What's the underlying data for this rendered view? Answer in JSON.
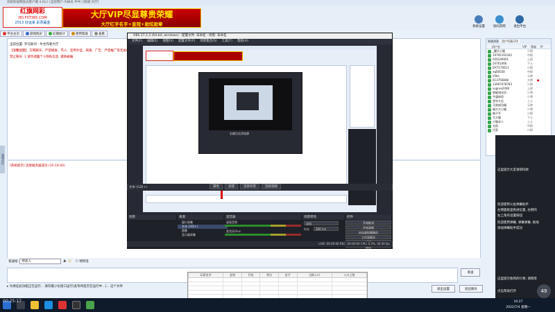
{
  "window_title": "云帆科技网会员客户端 4.0(c) (当前用户:大帐号 牛牛) [频道:大厅]",
  "logo": {
    "line1": "红旗网彩",
    "line2": "HD.FXT365.COM",
    "line3": "2013 好运来 彩票赢金"
  },
  "vip_banner": {
    "title": "大厅VIP尽显尊贵荣耀",
    "subtitle": "大厅红字名字+皇冠+勋炫勋章"
  },
  "window_buttons": [
    {
      "label": "系统设置"
    },
    {
      "label": "语问其网"
    },
    {
      "label": "退出平台"
    }
  ],
  "nav": [
    "平台主页",
    "游戏购买",
    "彩期统计",
    "使用帮助",
    "查看"
  ],
  "chat": {
    "lines": [
      {
        "text": "当前位置: 罗马斯对 - 牛合作者大厅",
        "color": "#222"
      },
      {
        "text": "【温馨提醒】 方网聊天、严禁刷屏、骂人、宣传外挂、病毒、广告、严禁推广等无关话题, 违者立即拉黑!",
        "color": "#c00"
      },
      {
        "text": "禁止聊天: 1 请勿透露个人隐私信息, 谨防被骗",
        "color": "#c00"
      },
      {
        "text": "[系统提示] 连接服务器成功 (10:19:40)",
        "color": "#c00"
      }
    ]
  },
  "left_strip": "游戏大厅",
  "user_panel": {
    "tabs": [
      "系统消息",
      "用户列表(20)"
    ],
    "headers": [
      "用户名",
      "VIP",
      "等级",
      "IP"
    ],
    "users": [
      {
        "name": "_醒天小猫",
        "rank": "少尉",
        "flag": ""
      },
      {
        "name": "19792192342",
        "rank": "中尉",
        "flag": ""
      },
      {
        "name": "A56249001",
        "rank": "上尉",
        "flag": ""
      },
      {
        "name": "54761066",
        "rank": "下士",
        "flag": ""
      },
      {
        "name": "DX7170011",
        "rank": "少尉",
        "flag": ""
      },
      {
        "name": "eq00030",
        "rank": "中尉",
        "flag": ""
      },
      {
        "name": "lrlike",
        "rank": "元帅",
        "flag": ""
      },
      {
        "name": "013756848",
        "rank": "大将",
        "flag": "●"
      },
      {
        "name": "13907078783",
        "rank": "少尉",
        "flag": ""
      },
      {
        "name": "sugrue2008",
        "rank": "上尉",
        "flag": ""
      },
      {
        "name": "智能测试员",
        "rank": "少将",
        "flag": ""
      },
      {
        "name": "牛逼体验",
        "rank": "少将",
        "flag": ""
      },
      {
        "name": "虎年大吉",
        "rank": "上士",
        "flag": ""
      },
      {
        "name": "马到成功福",
        "rank": "元帅",
        "flag": ""
      },
      {
        "name": "福大大小猫",
        "rank": "少将",
        "flag": ""
      },
      {
        "name": "做子手",
        "rank": "少尉",
        "flag": ""
      },
      {
        "name": "大大猫",
        "rank": "下士",
        "flag": ""
      },
      {
        "name": "小猫本人",
        "rank": "上士",
        "flag": ""
      },
      {
        "name": "太阳",
        "rank": "中尉",
        "flag": ""
      },
      {
        "name": "月亮",
        "rank": "少尉",
        "flag": ""
      }
    ]
  },
  "send_bar": {
    "label": "发送给:",
    "target": "所有人",
    "option": "悄悄话"
  },
  "send_button": "发送",
  "bottom_text": "为保证此功能正在运行... 请勿最小化窗口运行[此等待是否在运行中...]... 这个文件",
  "bottom_buttons": [
    "退出设置",
    "退出聊天"
  ],
  "obs": {
    "title": "OBS 27.2.3 (64-bit, windows) - 配置文件: 未命名 - 场景: 未命名",
    "menu": [
      "文件(F)",
      "编辑(E)",
      "视图(V)",
      "配置文件(P)",
      "场景集合(S)",
      "工具(T)",
      "帮助(H)"
    ],
    "nested_text": "右键点击添加源",
    "bar_label": "文本 (GDI+)",
    "bar_buttons": [
      "属性",
      "滤镜",
      "选择背景",
      "选择源颜"
    ],
    "docks": [
      "场景",
      "来源",
      "混音器",
      "场景转场",
      "控件"
    ],
    "sources": [
      "窗口采集",
      "文本 (GDI+)",
      "图像",
      "显示器采集"
    ],
    "mixer": [
      "桌面音频",
      "麦克风/Aux"
    ],
    "transition": {
      "type": "淡出",
      "duration_label": "时长",
      "duration": "300 ms"
    },
    "controls": [
      "开始推流",
      "开始录制",
      "启动虚拟摄像机",
      "工作室模式",
      "设置",
      "退出"
    ],
    "status": "LIVE: 00:00:00   REC: 00:00:00   CPU: 0.5%, 30.00 fps"
  },
  "table": {
    "headers": [
      "玩家名字",
      "金钱",
      "开关",
      "积分",
      "金子",
      "当前入口",
      "入口上限"
    ]
  },
  "right_panel": {
    "lines": [
      "这里提示大友请得码款",
      "欢迎使用斗鱼弹幕助手",
      "左侧面板里拖进位置, 左侧的",
      "右上角有设置按钮",
      "欢迎使用弹幕, 弹幕弹幕, 拖线",
      "添加弹幕助手成功",
      "这里提示收到的礼物, 请稍等",
      "点击帮助打开"
    ],
    "timer": "49"
  },
  "clock": {
    "time": "10:27",
    "date": "2022/7/4 星期一"
  },
  "watermark": "00:25:17"
}
